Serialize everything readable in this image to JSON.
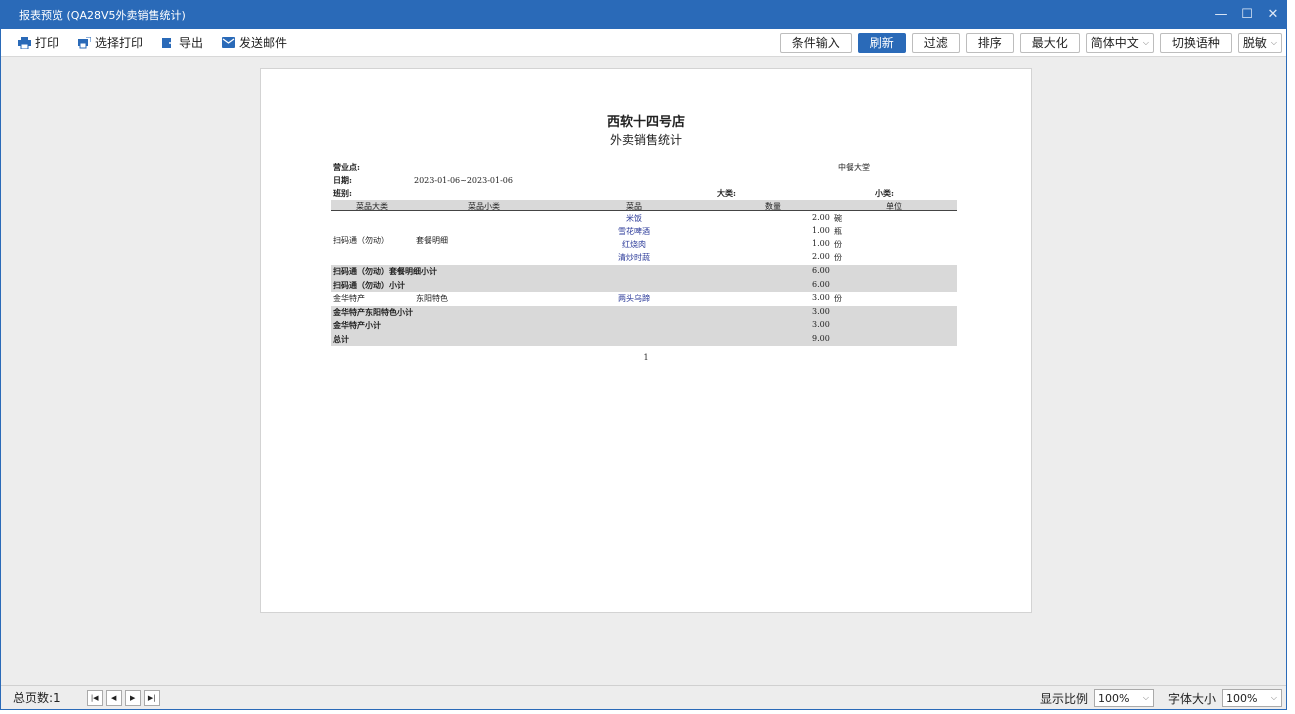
{
  "window": {
    "title": "报表预览 (QA28V5外卖销售统计)",
    "controls": {
      "minimize": "—",
      "maximize": "☐",
      "close": "✕"
    }
  },
  "toolbar": {
    "left": [
      {
        "label": "打印",
        "icon": "printer-icon"
      },
      {
        "label": "选择打印",
        "icon": "select-print-icon"
      },
      {
        "label": "导出",
        "icon": "export-icon"
      },
      {
        "label": "发送邮件",
        "icon": "mail-icon"
      }
    ],
    "buttons": {
      "condition": "条件输入",
      "refresh": "刷新",
      "filter": "过滤",
      "sort": "排序",
      "maximize": "最大化",
      "switch_lang": "切换语种"
    },
    "language_select": "简体中文",
    "mask_select": "脱敏",
    "accent": "#2a6ab8"
  },
  "report": {
    "store": "西软十四号店",
    "title": "外卖销售统计",
    "labels": {
      "outlet": "营业点:",
      "date": "日期:",
      "shift": "班别:",
      "category": "大类:",
      "subcategory": "小类:"
    },
    "outlet_value": "中餐大堂",
    "date_value": "2023-01-06~2023-01-06",
    "columns": [
      "菜品大类",
      "菜品小类",
      "菜品",
      "数量",
      "单位"
    ],
    "group1": {
      "category": "扫码通（勿动）",
      "subcategory": "套餐明细"
    },
    "rows": [
      {
        "dish": "米饭",
        "qty": "2.00",
        "unit": "碗"
      },
      {
        "dish": "雪花啤酒",
        "qty": "1.00",
        "unit": "瓶"
      },
      {
        "dish": "红烧肉",
        "qty": "1.00",
        "unit": "份"
      },
      {
        "dish": "清炒时蔬",
        "qty": "2.00",
        "unit": "份"
      }
    ],
    "subtotal1a": {
      "label": "扫码通（勿动）套餐明细小计",
      "qty": "6.00"
    },
    "subtotal1b": {
      "label": "扫码通（勿动）小计",
      "qty": "6.00"
    },
    "row2": {
      "category": "金华特产",
      "subcategory": "东阳特色",
      "dish": "两头乌蹄",
      "qty": "3.00",
      "unit": "份"
    },
    "subtotal2a": {
      "label": "金华特产东阳特色小计",
      "qty": "3.00"
    },
    "subtotal2b": {
      "label": "金华特产小计",
      "qty": "3.00"
    },
    "total": {
      "label": "总计",
      "qty": "9.00"
    },
    "page_number": "1"
  },
  "status": {
    "pages": "总页数:1",
    "nav": [
      "|◀",
      "◀",
      "▶",
      "▶|"
    ],
    "zoom_label": "显示比例",
    "zoom_value": "100%",
    "font_label": "字体大小",
    "font_value": "100%"
  }
}
